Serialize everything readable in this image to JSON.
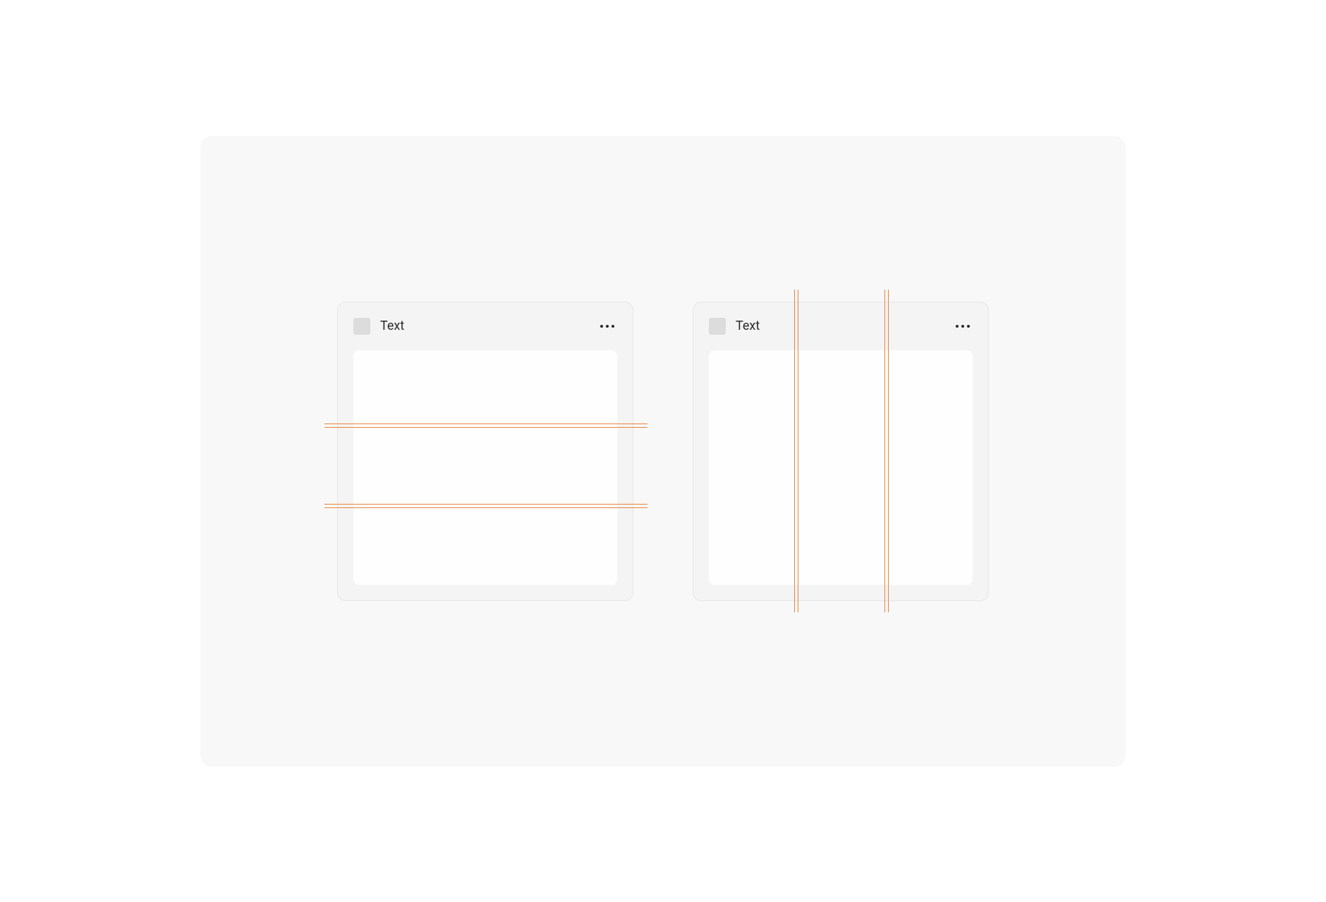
{
  "cards": {
    "left": {
      "title": "Text"
    },
    "right": {
      "title": "Text"
    }
  },
  "guides": {
    "color": "#e8833a",
    "leftCard": {
      "orientation": "horizontal",
      "count": 2
    },
    "rightCard": {
      "orientation": "vertical",
      "count": 2
    }
  }
}
